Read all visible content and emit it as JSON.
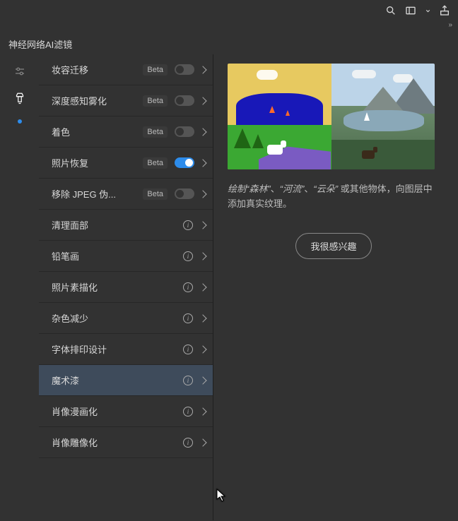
{
  "panel_title": "神经网络AI滤镜",
  "filters": [
    {
      "label": "妆容迁移",
      "beta": true,
      "toggle": "off"
    },
    {
      "label": "深度感知雾化",
      "beta": true,
      "toggle": "off"
    },
    {
      "label": "着色",
      "beta": true,
      "toggle": "off"
    },
    {
      "label": "照片恢复",
      "beta": true,
      "toggle": "on"
    },
    {
      "label": "移除 JPEG 伪...",
      "beta": true,
      "toggle": "off"
    },
    {
      "label": "清理面部",
      "info": true
    },
    {
      "label": "铅笔画",
      "info": true
    },
    {
      "label": "照片素描化",
      "info": true
    },
    {
      "label": "杂色减少",
      "info": true
    },
    {
      "label": "字体排印设计",
      "info": true
    },
    {
      "label": "魔术漆",
      "info": true,
      "selected": true
    },
    {
      "label": "肖像漫画化",
      "info": true
    },
    {
      "label": "肖像雕像化",
      "info": true
    }
  ],
  "detail": {
    "desc_prefix": "绘制",
    "w1": "“森林”",
    "sep": "、",
    "w2": "“河流”",
    "w3": "“云朵”",
    "desc_suffix": " 或其他物体，向图层中添加真实纹理。",
    "interest_button": "我很感兴趣"
  }
}
